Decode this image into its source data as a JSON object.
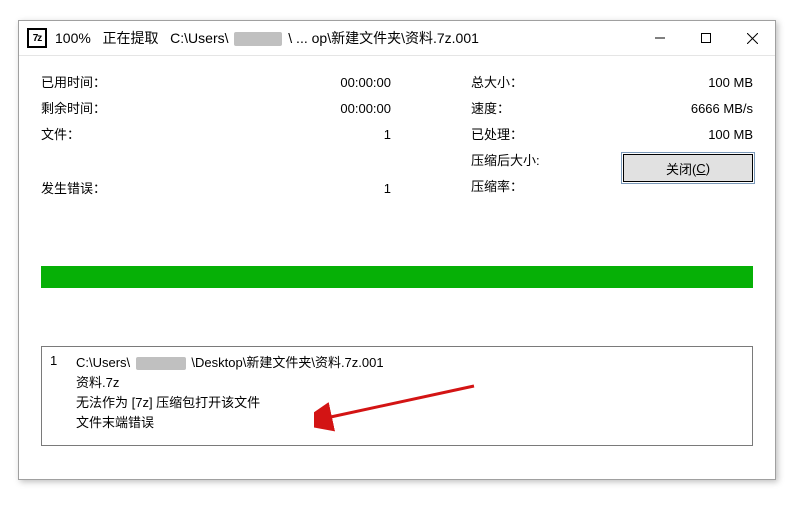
{
  "title": {
    "percent": "100%",
    "action": "正在提取",
    "path_prefix": "C:\\Users\\",
    "path_suffix": "\\ ... op\\新建文件夹\\资料.7z.001"
  },
  "stats": {
    "left": {
      "elapsed_label": "已用时间：",
      "elapsed_value": "00:00:00",
      "remaining_label": "剩余时间：",
      "remaining_value": "00:00:00",
      "files_label": "文件：",
      "files_value": "1",
      "errors_label": "发生错误：",
      "errors_value": "1"
    },
    "right": {
      "total_label": "总大小：",
      "total_value": "100 MB",
      "speed_label": "速度：",
      "speed_value": "6666 MB/s",
      "processed_label": "已处理：",
      "processed_value": "100 MB",
      "compressed_label": "压缩后大小:",
      "compressed_value": "",
      "ratio_label": "压缩率：",
      "ratio_value": ""
    }
  },
  "log": {
    "index": "1",
    "line1_prefix": "C:\\Users\\",
    "line1_suffix": "\\Desktop\\新建文件夹\\资料.7z.001",
    "line2": "资料.7z",
    "line3": "无法作为 [7z] 压缩包打开该文件",
    "line4": "文件末端错误"
  },
  "buttons": {
    "close_label": "关闭(",
    "close_mnemonic": "C",
    "close_suffix": ")"
  }
}
